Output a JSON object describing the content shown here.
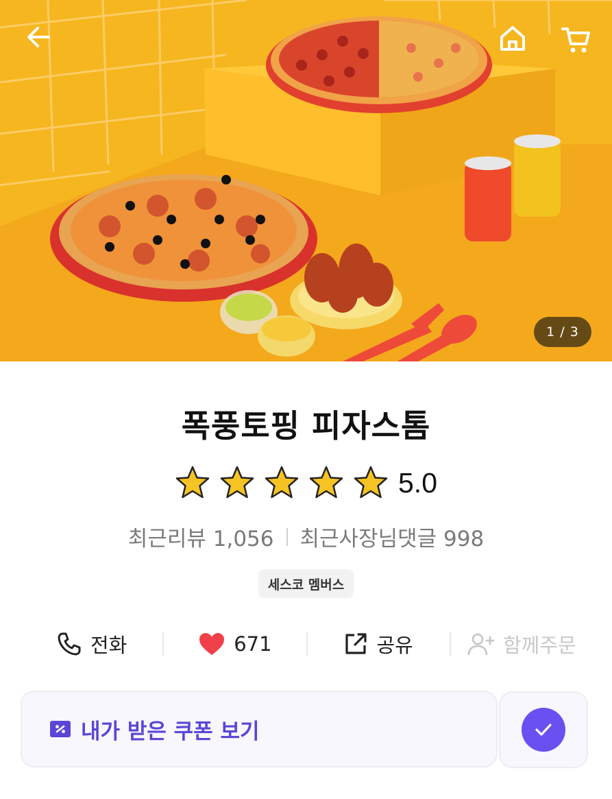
{
  "header": {
    "back_icon": "back-arrow-icon",
    "home_icon": "home-icon",
    "cart_icon": "cart-icon",
    "image_page": "1 / 3"
  },
  "store": {
    "name": "폭풍토핑 피자스톰",
    "rating": "5.0",
    "rating_stars": 5,
    "reviews": "최근리뷰 1,056",
    "owner_replies": "최근사장님댓글 998",
    "badge": "세스코 멤버스"
  },
  "actions": {
    "call_label": "전화",
    "likes": "671",
    "share_label": "공유",
    "group_order_label": "함께주문"
  },
  "coupon": {
    "label": "내가 받은 쿠폰 보기"
  },
  "colors": {
    "accent": "#6a50f0",
    "coupon_text": "#5a46d6",
    "heart": "#f0414b",
    "star": "#f5c424"
  }
}
